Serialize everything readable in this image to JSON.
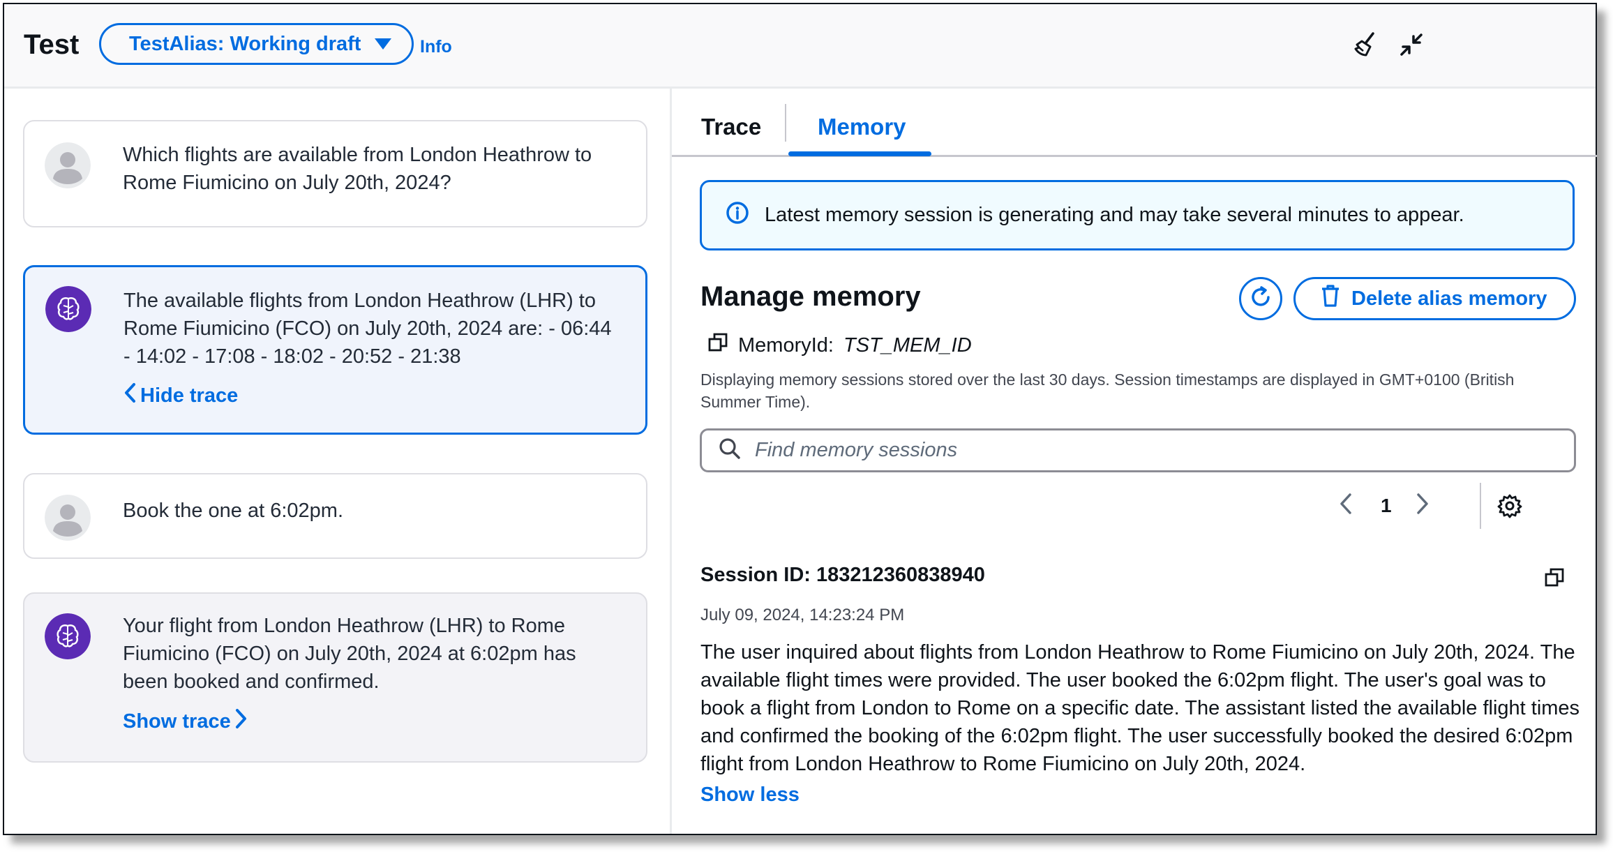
{
  "header": {
    "title": "Test",
    "alias_label": "TestAlias: Working draft",
    "info_label": "Info"
  },
  "messages": [
    {
      "role": "user",
      "text": "Which flights are available from London Heathrow to Rome Fiumicino on July 20th, 2024?"
    },
    {
      "role": "agent",
      "text": "The available flights from London Heathrow (LHR) to Rome Fiumicino (FCO) on July 20th, 2024 are: - 06:44 - 14:02 - 17:08 - 18:02 - 20:52 - 21:38",
      "trace_label": "Hide trace"
    },
    {
      "role": "user",
      "text": "Book the one at 6:02pm."
    },
    {
      "role": "agent",
      "text": "Your flight from London Heathrow (LHR) to Rome Fiumicino (FCO) on July 20th, 2024 at 6:02pm has been booked and confirmed.",
      "trace_label": "Show trace"
    }
  ],
  "tabs": [
    {
      "label": "Trace"
    },
    {
      "label": "Memory"
    }
  ],
  "alert": {
    "text": "Latest memory session is generating and may take several minutes to appear."
  },
  "memory": {
    "heading": "Manage memory",
    "delete_label": "Delete alias memory",
    "memory_id_label": "MemoryId:",
    "memory_id_value": "TST_MEM_ID",
    "description": "Displaying memory sessions stored over the last 30 days. Session timestamps are displayed in GMT+0100 (British Summer Time).",
    "search_placeholder": "Find memory sessions",
    "page": "1"
  },
  "session": {
    "id_label": "Session ID: 183212360838940",
    "timestamp": "July 09, 2024, 14:23:24 PM",
    "summary": "The user inquired about flights from London Heathrow to Rome Fiumicino on July 20th, 2024. The available flight times were provided. The user booked the 6:02pm flight. The user's goal was to book a flight from London to Rome on a specific date. The assistant listed the available flight times and confirmed the booking of the 6:02pm flight. The user successfully booked the desired 6:02pm flight from London Heathrow to Rome Fiumicino on July 20th, 2024.",
    "show_less_label": "Show less"
  },
  "colors": {
    "accent": "#006ce0",
    "selected_bg": "#f0f4fc",
    "agent_avatar": "#5b2bb4",
    "alert_bg": "#f0fbff"
  }
}
